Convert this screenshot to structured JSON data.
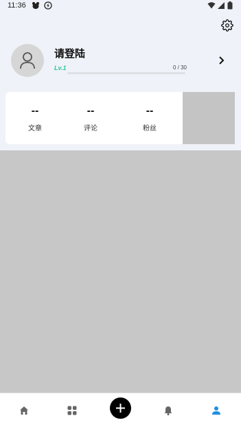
{
  "status_bar": {
    "time": "11:36"
  },
  "profile": {
    "login_prompt": "请登陆",
    "level": "Lv.1",
    "exp": "0 / 30",
    "exp_progress": 0
  },
  "stats": [
    {
      "value": "--",
      "label": "文章"
    },
    {
      "value": "--",
      "label": "评论"
    },
    {
      "value": "--",
      "label": "粉丝"
    }
  ],
  "colors": {
    "accent": "#2bc3a4",
    "nav_active": "#1e8fe1",
    "nav_inactive": "#666666",
    "header_bg": "#eff2f8"
  },
  "nav": {
    "items": [
      "home-icon",
      "grid-icon",
      "plus-icon",
      "bell-icon",
      "user-icon"
    ],
    "active": "user-icon"
  }
}
